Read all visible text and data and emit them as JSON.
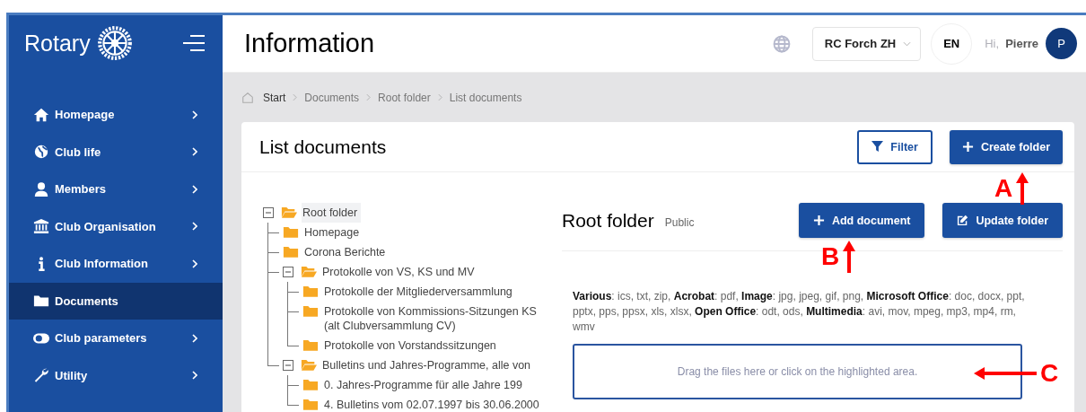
{
  "sidebar": {
    "brand": "Rotary",
    "items": [
      {
        "label": "Homepage",
        "selected": false,
        "has_submenu": true
      },
      {
        "label": "Club life",
        "selected": false,
        "has_submenu": true
      },
      {
        "label": "Members",
        "selected": false,
        "has_submenu": true
      },
      {
        "label": "Club Organisation",
        "selected": false,
        "has_submenu": true
      },
      {
        "label": "Club Information",
        "selected": false,
        "has_submenu": true
      },
      {
        "label": "Documents",
        "selected": true,
        "has_submenu": false
      },
      {
        "label": "Club parameters",
        "selected": false,
        "has_submenu": true
      },
      {
        "label": "Utility",
        "selected": false,
        "has_submenu": true
      }
    ]
  },
  "header": {
    "title": "Information",
    "club_select": "RC Forch ZH",
    "language": "EN",
    "greeting": "Hi,",
    "user_name": "Pierre",
    "avatar_initial": "P"
  },
  "breadcrumb": [
    "Start",
    "Documents",
    "Root folder",
    "List documents"
  ],
  "card": {
    "title": "List documents",
    "filter_button": "Filter",
    "create_button": "Create folder"
  },
  "tree": [
    {
      "label": "Root folder",
      "selected": true,
      "expanded": true,
      "children": [
        {
          "label": "Homepage",
          "selected": false
        },
        {
          "label": "Corona Berichte",
          "selected": false
        },
        {
          "label": "Protokolle von VS, KS und MV",
          "selected": false,
          "expanded": true,
          "children": [
            {
              "label": "Protokolle der Mitgliederversammlung",
              "selected": false
            },
            {
              "label": "Protokolle von Kommissions-Sitzungen KS (alt Clubversammlung CV)",
              "selected": false
            },
            {
              "label": "Protokolle von Vorstandssitzungen",
              "selected": false
            }
          ]
        },
        {
          "label": "Bulletins und Jahres-Programme, alle von",
          "selected": false,
          "expanded": true,
          "children": [
            {
              "label": "0. Jahres-Programme für alle Jahre 199",
              "selected": false
            },
            {
              "label": "4. Bulletins vom 02.07.1997 bis 30.06.2000",
              "selected": false
            }
          ]
        }
      ]
    }
  ],
  "folder_panel": {
    "title": "Root folder",
    "visibility": "Public",
    "add_button": "Add document",
    "update_button": "Update folder",
    "file_types": "**Various**: ics, txt, zip,   **Acrobat**: pdf,   **Image**: jpg, jpeg, gif, png,   **Microsoft Office**: doc, docx, ppt, pptx, pps, ppsx, xls, xlsx,   **Open Office**: odt, ods,   **Multimedia**: avi, mov, mpeg, mp3, mp4, rm, wmv",
    "dropzone": "Drag the files here or click on the highlighted area."
  },
  "annotations": [
    {
      "label": "A"
    },
    {
      "label": "B"
    },
    {
      "label": "C"
    }
  ]
}
